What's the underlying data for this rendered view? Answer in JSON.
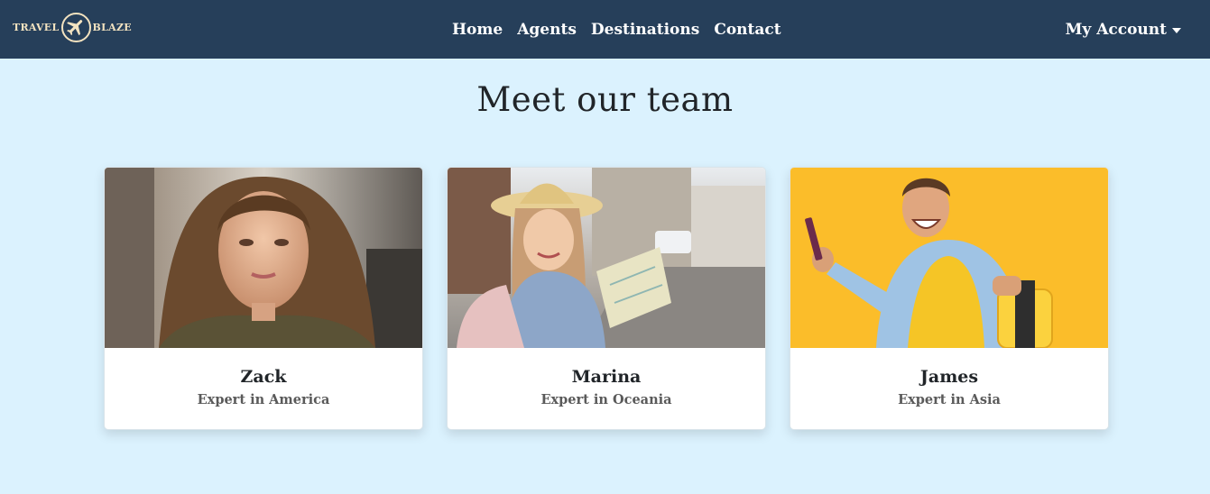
{
  "brand": {
    "left_text": "TRAVEL",
    "right_text": "BLAZE",
    "logo_icon": "airplane-icon"
  },
  "nav": {
    "links": [
      {
        "label": "Home"
      },
      {
        "label": "Agents"
      },
      {
        "label": "Destinations"
      },
      {
        "label": "Contact"
      }
    ],
    "account_label": "My Account"
  },
  "main": {
    "title": "Meet our team",
    "team": [
      {
        "name": "Zack",
        "role": "Expert in America",
        "photo": "woman-portrait"
      },
      {
        "name": "Marina",
        "role": "Expert in Oceania",
        "photo": "tourist-with-map"
      },
      {
        "name": "James",
        "role": "Expert in Asia",
        "photo": "man-with-suitcase"
      }
    ]
  },
  "colors": {
    "navbar": "#263f5a",
    "page_background": "#dbf2fe",
    "brand": "#f3e3c0"
  }
}
